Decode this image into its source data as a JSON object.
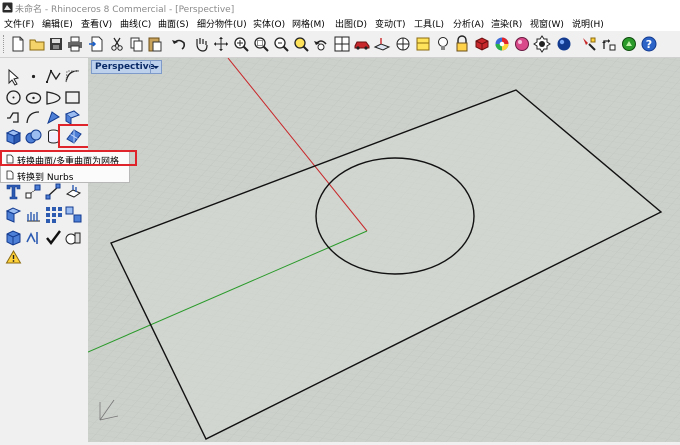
{
  "window": {
    "title": "未命名 - Rhinoceros 8 Commercial - [Perspective]"
  },
  "menu": [
    "文件(F)",
    "编辑(E)",
    "查看(V)",
    "曲线(C)",
    "曲面(S)",
    "细分物件(U)",
    "实体(O)",
    "网格(M)",
    "出图(D)",
    "变动(T)",
    "工具(L)",
    "分析(A)",
    "渲染(R)",
    "视窗(W)",
    "说明(H)"
  ],
  "viewport": {
    "tab_label": "Perspective"
  },
  "flyout": {
    "items": [
      {
        "label": "转换曲面/多重曲面为网格",
        "highlighted": true
      },
      {
        "label": "转换到 Nurbs",
        "highlighted": false
      }
    ]
  },
  "colors": {
    "highlight": "#e0242b",
    "viewport_bg": "#cdd1cc",
    "axis_x": "#c8282b",
    "axis_y": "#2a9a2a"
  },
  "icons": {
    "toolbar": [
      "new-file-icon",
      "open-folder-icon",
      "save-icon",
      "print-icon",
      "import-icon",
      "cut-icon",
      "copy-icon",
      "paste-icon",
      "undo-icon",
      "pan-hand-icon",
      "rotate-view-icon",
      "zoom-dynamic-icon",
      "zoom-window-icon",
      "zoom-extents-icon",
      "zoom-selected-icon",
      "undo-view-icon",
      "four-viewports-icon",
      "car-icon",
      "set-cplane-icon",
      "display-mode-icon",
      "layer-icon",
      "light-bulb-icon",
      "lock-icon",
      "material-icon",
      "color-wheel-icon",
      "render-sphere-icon",
      "render-preview-icon",
      "sphere-shaded-icon",
      "options-icon",
      "gumball-icon",
      "grasshopper-icon",
      "help-icon"
    ],
    "left": [
      "select-arrow-icon",
      "point-icon",
      "polyline-icon",
      "curve-control-points-icon",
      "circle-icon",
      "arc-icon",
      "rectangle-icon",
      "ellipse-icon",
      "polygon-icon",
      "freeform-curve-icon",
      "curve-tools-icon",
      "surface-icon",
      "box-icon",
      "boolean-icon",
      "cylinder-icon",
      "mesh-convert-icon",
      "text-icon",
      "transform-icon",
      "array-icon",
      "extrude-icon",
      "explode-icon",
      "join-icon",
      "group-icon",
      "check-icon",
      "shade-icon",
      "analyze-icon",
      "paint-icon"
    ]
  }
}
